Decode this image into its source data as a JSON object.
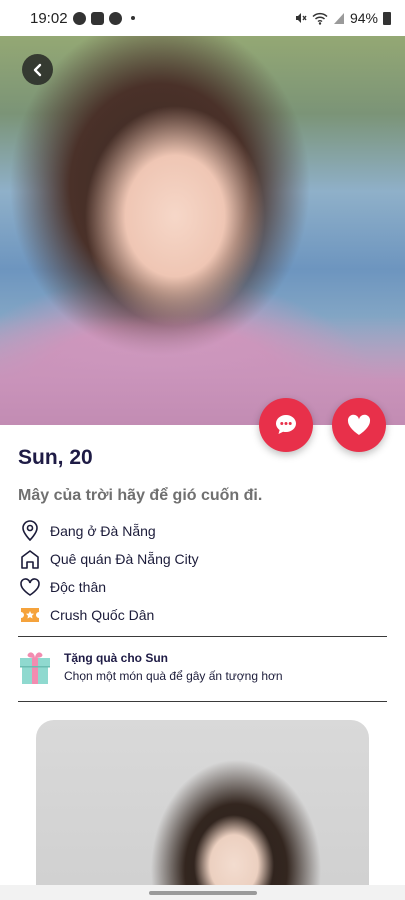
{
  "status_bar": {
    "time": "19:02",
    "battery": "94%",
    "left_icons": [
      "messenger-icon",
      "message-icon",
      "facebook-icon",
      "dot"
    ],
    "right_icons": [
      "mute-icon",
      "wifi-icon",
      "signal-icon",
      "battery-icon"
    ]
  },
  "profile": {
    "name_age": "Sun, 20",
    "bio": "Mây của trời hãy để gió cuốn đi.",
    "details": [
      {
        "icon": "location-icon",
        "text": "Đang ở Đà Nẵng"
      },
      {
        "icon": "home-icon",
        "text": "Quê quán Đà Nẵng City"
      },
      {
        "icon": "heart-outline-icon",
        "text": "Độc thân"
      },
      {
        "icon": "ticket-icon",
        "text": "Crush Quốc Dân"
      }
    ]
  },
  "gift": {
    "title": "Tặng quà cho Sun",
    "subtitle": "Chọn một món quà để gây ấn tượng hơn"
  },
  "colors": {
    "accent": "#e8304a",
    "name": "#1e1b45",
    "bio": "#707070",
    "ticket": "#f5a33c",
    "gift": "#8fd9cf"
  }
}
